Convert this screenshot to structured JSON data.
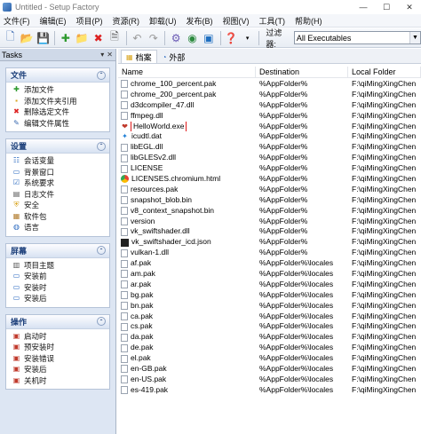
{
  "window": {
    "title": "Untitled - Setup Factory",
    "min_label": "—",
    "max_label": "☐",
    "close_label": "✕"
  },
  "menu": [
    "文件(F)",
    "编辑(E)",
    "项目(P)",
    "资源(R)",
    "卸载(U)",
    "发布(B)",
    "视图(V)",
    "工具(T)",
    "帮助(H)"
  ],
  "toolbar": {
    "filter_label": "过滤器:",
    "filter_value": "All Executables"
  },
  "tasks": {
    "title": "Tasks",
    "groups": [
      {
        "title": "文件",
        "items": [
          "添加文件",
          "添加文件夹引用",
          "删除选定文件",
          "编辑文件属性"
        ]
      },
      {
        "title": "设置",
        "items": [
          "会话变量",
          "背景窗口",
          "系统要求",
          "日志文件",
          "安全",
          "软件包",
          "语言"
        ]
      },
      {
        "title": "屏幕",
        "items": [
          "项目主题",
          "安装前",
          "安装时",
          "安装后"
        ]
      },
      {
        "title": "操作",
        "items": [
          "启动时",
          "预安装时",
          "安装错误",
          "安装后",
          "关机时"
        ]
      }
    ]
  },
  "tabs": [
    {
      "label": "档案",
      "active": true
    },
    {
      "label": "外部",
      "active": false
    }
  ],
  "columns": {
    "name": "Name",
    "destination": "Destination",
    "local_folder": "Local Folder"
  },
  "files": [
    {
      "name": "chrome_100_percent.pak",
      "dest": "%AppFolder%",
      "local": "F:\\qiMingXingChen",
      "icon": "file"
    },
    {
      "name": "chrome_200_percent.pak",
      "dest": "%AppFolder%",
      "local": "F:\\qiMingXingChen",
      "icon": "file"
    },
    {
      "name": "d3dcompiler_47.dll",
      "dest": "%AppFolder%",
      "local": "F:\\qiMingXingChen",
      "icon": "file"
    },
    {
      "name": "ffmpeg.dll",
      "dest": "%AppFolder%",
      "local": "F:\\qiMingXingChen",
      "icon": "file"
    },
    {
      "name": "HelloWorld.exe",
      "dest": "%AppFolder%",
      "local": "F:\\qiMingXingChen",
      "icon": "exe"
    },
    {
      "name": "icudtl.dat",
      "dest": "%AppFolder%",
      "local": "F:\\qiMingXingChen",
      "icon": "dat"
    },
    {
      "name": "libEGL.dll",
      "dest": "%AppFolder%",
      "local": "F:\\qiMingXingChen",
      "icon": "file"
    },
    {
      "name": "libGLESv2.dll",
      "dest": "%AppFolder%",
      "local": "F:\\qiMingXingChen",
      "icon": "file"
    },
    {
      "name": "LICENSE",
      "dest": "%AppFolder%",
      "local": "F:\\qiMingXingChen",
      "icon": "file"
    },
    {
      "name": "LICENSES.chromium.html",
      "dest": "%AppFolder%",
      "local": "F:\\qiMingXingChen",
      "icon": "chrome"
    },
    {
      "name": "resources.pak",
      "dest": "%AppFolder%",
      "local": "F:\\qiMingXingChen",
      "icon": "file"
    },
    {
      "name": "snapshot_blob.bin",
      "dest": "%AppFolder%",
      "local": "F:\\qiMingXingChen",
      "icon": "file"
    },
    {
      "name": "v8_context_snapshot.bin",
      "dest": "%AppFolder%",
      "local": "F:\\qiMingXingChen",
      "icon": "file"
    },
    {
      "name": "version",
      "dest": "%AppFolder%",
      "local": "F:\\qiMingXingChen",
      "icon": "file"
    },
    {
      "name": "vk_swiftshader.dll",
      "dest": "%AppFolder%",
      "local": "F:\\qiMingXingChen",
      "icon": "file"
    },
    {
      "name": "vk_swiftshader_icd.json",
      "dest": "%AppFolder%",
      "local": "F:\\qiMingXingChen",
      "icon": "json"
    },
    {
      "name": "vulkan-1.dll",
      "dest": "%AppFolder%",
      "local": "F:\\qiMingXingChen",
      "icon": "file"
    },
    {
      "name": "af.pak",
      "dest": "%AppFolder%\\locales",
      "local": "F:\\qiMingXingChen",
      "icon": "file"
    },
    {
      "name": "am.pak",
      "dest": "%AppFolder%\\locales",
      "local": "F:\\qiMingXingChen",
      "icon": "file"
    },
    {
      "name": "ar.pak",
      "dest": "%AppFolder%\\locales",
      "local": "F:\\qiMingXingChen",
      "icon": "file"
    },
    {
      "name": "bg.pak",
      "dest": "%AppFolder%\\locales",
      "local": "F:\\qiMingXingChen",
      "icon": "file"
    },
    {
      "name": "bn.pak",
      "dest": "%AppFolder%\\locales",
      "local": "F:\\qiMingXingChen",
      "icon": "file"
    },
    {
      "name": "ca.pak",
      "dest": "%AppFolder%\\locales",
      "local": "F:\\qiMingXingChen",
      "icon": "file"
    },
    {
      "name": "cs.pak",
      "dest": "%AppFolder%\\locales",
      "local": "F:\\qiMingXingChen",
      "icon": "file"
    },
    {
      "name": "da.pak",
      "dest": "%AppFolder%\\locales",
      "local": "F:\\qiMingXingChen",
      "icon": "file"
    },
    {
      "name": "de.pak",
      "dest": "%AppFolder%\\locales",
      "local": "F:\\qiMingXingChen",
      "icon": "file"
    },
    {
      "name": "el.pak",
      "dest": "%AppFolder%\\locales",
      "local": "F:\\qiMingXingChen",
      "icon": "file"
    },
    {
      "name": "en-GB.pak",
      "dest": "%AppFolder%\\locales",
      "local": "F:\\qiMingXingChen",
      "icon": "file"
    },
    {
      "name": "en-US.pak",
      "dest": "%AppFolder%\\locales",
      "local": "F:\\qiMingXingChen",
      "icon": "file"
    },
    {
      "name": "es-419.pak",
      "dest": "%AppFolder%\\locales",
      "local": "F:\\qiMingXingChen",
      "icon": "file"
    }
  ],
  "selected_file": "HelloWorld.exe"
}
